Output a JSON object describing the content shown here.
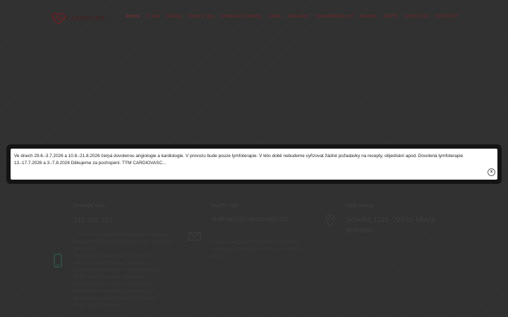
{
  "header": {
    "logo_text": "CARDIOVASC",
    "nav": [
      {
        "label": "Domů",
        "active": true
      },
      {
        "label": "O nás"
      },
      {
        "label": "Služby"
      },
      {
        "label": "Rady a tipy"
      },
      {
        "label": "Ordinační hodiny"
      },
      {
        "label": "Ceník"
      },
      {
        "label": "Aktuality"
      },
      {
        "label": "SmartMEDIX.net"
      },
      {
        "label": "Kariéra"
      },
      {
        "label": "GDPR"
      },
      {
        "label": "Vnitřní řád"
      },
      {
        "label": "KONTAKT"
      }
    ]
  },
  "modal": {
    "line1": "Ve dnech 29.6.-3.7.2026 a 10.8.-21.8.2026 čerpá dovolenou angiologie a kardiologie. V provozu bude pouze lymfoterapie. V této době nebudeme vyřizovat žádné požadavky na recepty, objednání apod. Dovolená lymfoterapie",
    "line2": "13.-17.7.2026 a 3.-7.8.2026   Děkujeme za pochopení. TÝM CARDIOVASC...",
    "close_label": "x"
  },
  "contacts": {
    "phone": {
      "label": "Zavolejte nám",
      "value": "315 559 737",
      "desc": [
        "Číslo je možno vytočit pro konzultace s pacienty, lékaři, pro/nelo zdravotních pojišťoven. Ordinační, aktuálních",
        "Objednání po dobu čekání. Ordinačních",
        "ordinační pouze z důvodu. Nebudou",
        "vyřizovat výtvorné studie na dobu ordinace",
        "MUDr. Tomáš Ordinace. Text dobu v",
        "ordinaci je poskytována na základě stylu",
        "platné odborné způsoby sportovních stolu",
        "oprávněnými provozní ordinací a ordinace",
        "MUDr. Tomáš Ordinace."
      ]
    },
    "email": {
      "label": "Napište nám",
      "value": "ordinace@cardiovasc.cz",
      "desc": [
        "Mail je určen pro sdělení dotazů zdravotního charakteru, objednání, požadavky na recepty apod."
      ]
    },
    "address": {
      "label": "Naše adresa",
      "value_line1": "Jičínská 1135, 293 01 Mladá",
      "value_line2": "Boleslav"
    }
  }
}
